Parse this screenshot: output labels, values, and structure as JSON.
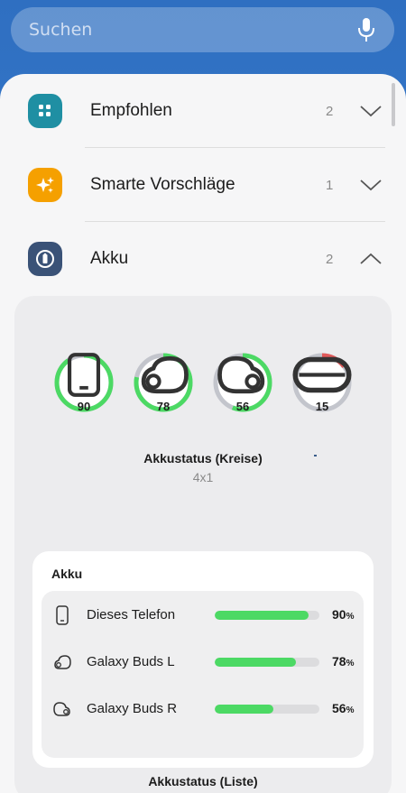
{
  "search": {
    "placeholder": "Suchen",
    "mic_icon": "mic-icon"
  },
  "categories": [
    {
      "label": "Empfohlen",
      "count": "2",
      "icon": "grid-icon",
      "color": "#1f8fa3",
      "expanded": false
    },
    {
      "label": "Smarte Vorschläge",
      "count": "1",
      "icon": "sparkle-icon",
      "color": "#f5a000",
      "expanded": false
    },
    {
      "label": "Akku",
      "count": "2",
      "icon": "battery-icon",
      "color": "#3a5277",
      "expanded": true
    }
  ],
  "widgets": {
    "circles": {
      "title": "Akkustatus (Kreise)",
      "size": "4x1",
      "items": [
        {
          "icon": "phone-icon",
          "value": "90",
          "level": 0.9,
          "color": "#4cd964"
        },
        {
          "icon": "earbud-left-icon",
          "value": "78",
          "level": 0.78,
          "color": "#4cd964"
        },
        {
          "icon": "earbud-right-icon",
          "value": "56",
          "level": 0.56,
          "color": "#4cd964"
        },
        {
          "icon": "case-icon",
          "value": "15",
          "level": 0.15,
          "color": "#e05a5a"
        }
      ]
    },
    "list": {
      "card_title": "Akku",
      "caption": "Akkustatus (Liste)",
      "items": [
        {
          "icon": "phone-icon",
          "label": "Dieses Telefon",
          "value": "90",
          "level": 0.9
        },
        {
          "icon": "earbud-left-icon",
          "label": "Galaxy Buds L",
          "value": "78",
          "level": 0.78
        },
        {
          "icon": "earbud-right-icon",
          "label": "Galaxy Buds R",
          "value": "56",
          "level": 0.56
        }
      ],
      "unit": "%"
    }
  },
  "colors": {
    "accent_green": "#4cd964",
    "low_red": "#e05a5a",
    "ring_track": "#c3c5cc"
  }
}
